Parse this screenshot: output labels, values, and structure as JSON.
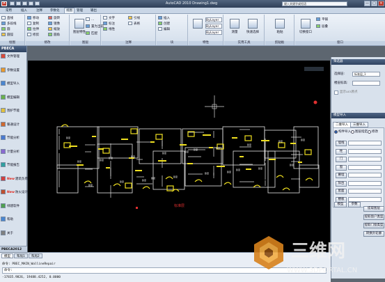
{
  "window": {
    "title": "AutoCAD 2010  Drawing1.dwg",
    "search_placeholder": "键入关键字或短语",
    "controls": [
      "—",
      "□",
      "✕"
    ]
  },
  "tabs": [
    "常用",
    "插入",
    "注释",
    "参数化",
    "视图",
    "管理",
    "输出"
  ],
  "ribbon": {
    "draw": {
      "items": [
        "直线",
        "多段线",
        "圆",
        "圆弧"
      ],
      "title": "绘图"
    },
    "modify": {
      "items": [
        "移动",
        "复制",
        "拉伸",
        "旋转",
        "镜像",
        "缩放",
        "修剪",
        "圆角",
        "阵列"
      ],
      "title": "修改"
    },
    "layers": {
      "items": [
        "图层特性",
        "未保存的图层状态",
        "置为当前",
        "匹配",
        "图层隔离"
      ],
      "title": "图层"
    },
    "annotation": {
      "items": [
        "文字",
        "标注",
        "线性",
        "引线",
        "表格"
      ],
      "title": "注释"
    },
    "block": {
      "items": [
        "插入",
        "创建",
        "编辑"
      ],
      "title": "块"
    },
    "properties": {
      "items": [
        "ByLayer",
        "ByLayer",
        "ByLayer"
      ],
      "title": "特性"
    },
    "utilities": {
      "items": [
        "测量",
        "快速选择"
      ],
      "title": "实用工具"
    },
    "clipboard": {
      "items": [
        "粘贴"
      ],
      "title": "剪贴板"
    },
    "window_panel": {
      "items": [
        "切换窗口",
        "平铺",
        "层叠"
      ],
      "title": "窗口"
    }
  },
  "left_panel": {
    "title": "PBECA",
    "items": [
      {
        "label": "文件管理",
        "new": false,
        "color": "#d84a3a"
      },
      {
        "label": "参数设置",
        "new": false,
        "color": "#e89a30"
      },
      {
        "label": "模型导入",
        "new": false,
        "color": "#4a86d0"
      },
      {
        "label": "模型编辑",
        "new": false,
        "color": "#6ab04c"
      },
      {
        "label": "围护节能",
        "new": false,
        "color": "#e0c040"
      },
      {
        "label": "暖通设计",
        "new": false,
        "color": "#d06a30"
      },
      {
        "label": "节能分析",
        "new": false,
        "color": "#4a7ad0"
      },
      {
        "label": "计量分析",
        "new": false,
        "color": "#8a6ad0"
      },
      {
        "label": "节能报告",
        "new": false,
        "color": "#30a0a0"
      },
      {
        "label": "建筑负荷",
        "new": true,
        "color": "#d04040"
      },
      {
        "label": "防火设计",
        "new": true,
        "color": "#c05030"
      },
      {
        "label": "绿建软件",
        "new": false,
        "color": "#50a050"
      },
      {
        "label": "帮助",
        "new": false,
        "color": "#4a86d0"
      },
      {
        "label": "关于",
        "new": false,
        "color": "#808080"
      }
    ],
    "footer": "PBECA2012"
  },
  "canvas": {
    "annotation": "标准层",
    "crosshair": "+"
  },
  "right_panel": {
    "filter": {
      "title": "筛选器",
      "select_label": "选择层:",
      "select_value": "标准层_1",
      "floor_label": "楼层标高:",
      "floor_value": "",
      "checkbox_label": "显示ucs原点"
    },
    "import": {
      "title": "模型导入",
      "tab1": "二维导入",
      "tab2": "三维导入",
      "radio": [
        "构件导入",
        "图层指定",
        "修改"
      ],
      "rows": [
        "墙线",
        "柱",
        "门",
        "窗",
        "幕墙",
        "阳台",
        "屋面",
        "楼板"
      ],
      "buttons": [
        "模型",
        "参数",
        "提取图层",
        "提取窗户类型",
        "提取门窗类型",
        "转换外轮廓"
      ]
    }
  },
  "command": {
    "layout_tabs": [
      "模型",
      "布局1",
      "布局2"
    ],
    "line1": "命令: PBEC_MAIN_WallineRepair",
    "line2": "命令:",
    "coords": "-17835.9826, 19488.4252, 0.0000"
  },
  "watermark": {
    "cn": "三维网",
    "url": "WWW.3DPORTAL.CN"
  }
}
